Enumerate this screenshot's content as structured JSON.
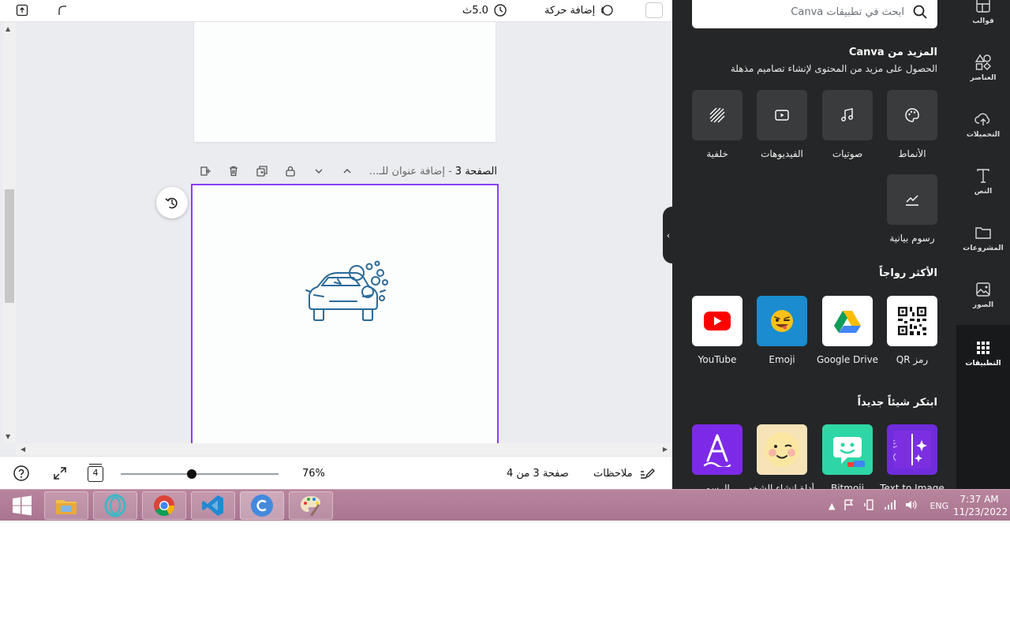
{
  "topbar": {
    "add_animation": "إضافة حركة",
    "duration": "5.0ث"
  },
  "page3": {
    "title": "الصفحة 3",
    "subtitle": "- إضافة عنوان للـ..."
  },
  "statusbar": {
    "notes": "ملاحظات",
    "page_indicator": "صفحة 3 من 4",
    "zoom": "76%",
    "zoom_fraction": 0.45,
    "page_count": "4"
  },
  "panel": {
    "search_placeholder": "ابحث في تطبيقات Canva",
    "more_title": "المزيد من Canva",
    "more_sub": "الحصول على مزيد من المحتوى لإنشاء تصاميم مذهلة",
    "more_tiles": [
      {
        "label": "الأنماط",
        "icon": "palette-icon"
      },
      {
        "label": "صوتيات",
        "icon": "music-note-icon"
      },
      {
        "label": "الفيديوهات",
        "icon": "video-icon"
      },
      {
        "label": "خلفية",
        "icon": "background-pattern-icon"
      },
      {
        "label": "رسوم بيانية",
        "icon": "chart-icon"
      }
    ],
    "popular_title": "الأكثر رواجاً",
    "popular_apps": [
      {
        "label": "رمز QR",
        "icon": "qr-code-icon"
      },
      {
        "label": "Google Drive",
        "icon": "google-drive-icon"
      },
      {
        "label": "Emoji",
        "icon": "emoji-icon"
      },
      {
        "label": "YouTube",
        "icon": "youtube-icon"
      }
    ],
    "new_title": "ابتكر شيئاً جديداً",
    "new_apps": [
      {
        "label": "Text to Image",
        "icon": "text-to-image-icon"
      },
      {
        "label": "Bitmoji",
        "icon": "bitmoji-icon"
      },
      {
        "label": "أداة إنشاء الشخصيات",
        "icon": "character-face-icon"
      },
      {
        "label": "الرسم",
        "icon": "draw-icon"
      }
    ]
  },
  "rail": [
    {
      "label": "قوالب",
      "icon": "templates-icon"
    },
    {
      "label": "العناصر",
      "icon": "elements-icon"
    },
    {
      "label": "التحميلات",
      "icon": "upload-cloud-icon"
    },
    {
      "label": "النص",
      "icon": "text-icon"
    },
    {
      "label": "المشروعات",
      "icon": "folder-icon"
    },
    {
      "label": "الصور",
      "icon": "photo-icon"
    },
    {
      "label": "التطبيقات",
      "icon": "apps-grid-icon"
    }
  ],
  "taskbar": {
    "language": "ENG",
    "time": "7:37 AM",
    "date": "11/23/2022"
  },
  "colors": {
    "accent": "#8b3dff",
    "panel_bg": "#252627",
    "rail_bg": "#18191b",
    "taskbar": "#b07a95"
  }
}
